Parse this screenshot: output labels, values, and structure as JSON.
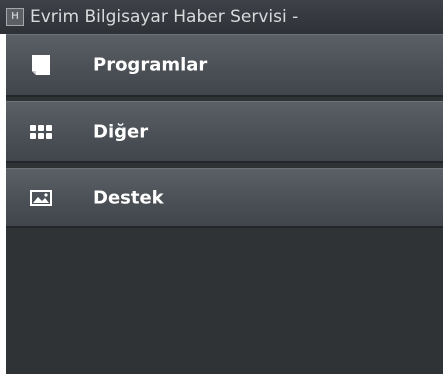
{
  "window": {
    "title": "Evrim Bilgisayar Haber Servisi -",
    "app_icon_glyph": "H"
  },
  "menu": {
    "items": [
      {
        "label": "Programlar",
        "icon": "document-icon"
      },
      {
        "label": "Diğer",
        "icon": "apps-grid-icon"
      },
      {
        "label": "Destek",
        "icon": "image-icon"
      }
    ]
  },
  "colors": {
    "titlebar": "#34383d",
    "panel_background": "#2f3336",
    "menu_item": "#4f545a",
    "label_text": "#ffffff"
  }
}
